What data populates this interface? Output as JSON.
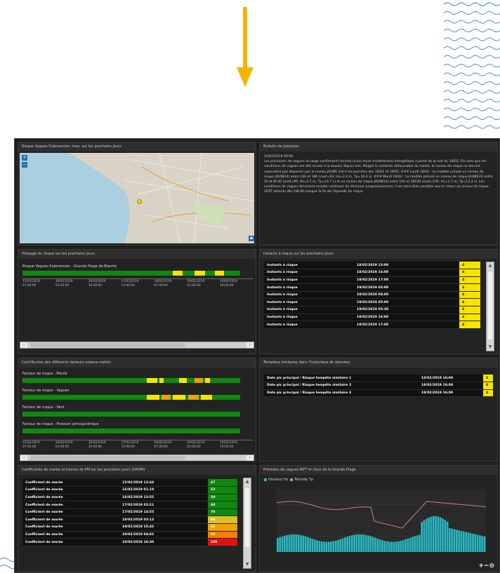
{
  "map_panel": {
    "title": "Risque Vagues-Submersion: max. sur les prochains jours",
    "zoom_in": "+",
    "zoom_out": "−"
  },
  "bulletin_panel": {
    "title": "Bulletin de prévision",
    "date": "15/02/2019 09:00",
    "text": "Les prévisions de vagues au large confirment l'arrivée d'une houle modérément énergétique à partir de la nuit du 18/02. On note que les conditions de vagues ont été revues à la hausse depuis hier. Malgré le contexte défavorable de marée, le niveau de risque ne devrait cependant pas dépasser pas le niveau JAUNE entre les journées des 18/02 et 19/02. ### Lundi 18/02 : Le modèle prévoit un niveau de risque JAUNE(4) entre 13h et 18h (coef=93, Hs=3.3 m, Tp=16.4 s). ### Mardi 19/02 : Le modèle prévoit un niveau de risque JAUNE(4) entre 2h et 6h30 (coef=99, Hs=3.1 m, Tp=14.7 s) et un niveau de risque JAUNE(4) entre 15h et 18h30 (coef=105, Hs=2.7 m, Tp=13.3 s). Les conditions de vagues devraient ensuite continuer de diminuer progressivement, il est alors bien possible que le retour au niveau de risque VERT attendu dès 18h30 marque la fin de l'épisode de risque."
  },
  "phasage_panel": {
    "title": "Phasage du risque sur les prochains jours",
    "series_label": "Risque Vagues-Submersion - Grande Plage de Biarritz",
    "ticks": [
      "15/02/2019\n07:00:00",
      "16/02/2019\n01:00:00",
      "16/02/2019\n19:00:00",
      "17/02/2019\n13:00:00",
      "18/02/2019\n07:00:00",
      "19/02/2019\n01:00:00",
      "19/02/2019\n19:00:00"
    ]
  },
  "instants_panel": {
    "title": "Instants à risque sur les prochains jours",
    "rows": [
      {
        "label": "Instants à risque",
        "date": "18/02/2019 13:00",
        "val": "4"
      },
      {
        "label": "Instants à risque",
        "date": "18/02/2019 16:00",
        "val": "4"
      },
      {
        "label": "Instants à risque",
        "date": "18/02/2019 17:00",
        "val": "4"
      },
      {
        "label": "Instants à risque",
        "date": "19/02/2019 03:00",
        "val": "4"
      },
      {
        "label": "Instants à risque",
        "date": "19/02/2019 04:00",
        "val": "4"
      },
      {
        "label": "Instants à risque",
        "date": "19/02/2019 05:00",
        "val": "4"
      },
      {
        "label": "Instants à risque",
        "date": "19/02/2019 05:30",
        "val": "4"
      },
      {
        "label": "Instants à risque",
        "date": "19/02/2019 16:00",
        "val": "4"
      },
      {
        "label": "Instants à risque",
        "date": "19/02/2019 17:00",
        "val": "4"
      }
    ]
  },
  "contrib_panel": {
    "title": "Contribution des différents facteurs océano-météo",
    "factors": [
      "Facteur de risque - Marée",
      "Facteur de risque - Vagues",
      "Facteur de risque - Vent",
      "Facteur de risque - Pression atmosphérique"
    ],
    "ticks": [
      "15/02/2019\n07:00:00",
      "16/02/2019\n01:00:00",
      "16/02/2019\n19:00:00",
      "17/02/2019\n13:00:00",
      "18/02/2019\n07:00:00",
      "19/02/2019\n01:00:00",
      "19/02/2019\n19:00:00"
    ]
  },
  "tempetes_panel": {
    "title": "Tempêtes similaires dans l'historique de données",
    "rows": [
      {
        "label": "Date pic principal / Risque tempête similaire 1",
        "date": "18/02/2019 16:00",
        "val": "4"
      },
      {
        "label": "Date pic principal / Risque tempête similaire 2",
        "date": "18/02/2019 16:00",
        "val": "4"
      },
      {
        "label": "Date pic principal / Risque tempête similaire 3",
        "date": "18/02/2019 16:00",
        "val": "4"
      }
    ]
  },
  "coef_panel": {
    "title": "Coefficients de marée et heures de PM sur les prochains jours (SHOM)",
    "rows": [
      {
        "label": "Coefficient de marée",
        "date": "15/02/2019 12:44",
        "val": "47",
        "color": "#0e8a0e"
      },
      {
        "label": "Coefficient de marée",
        "date": "16/02/2019 01:19",
        "val": "52",
        "color": "#0e8a0e"
      },
      {
        "label": "Coefficient de marée",
        "date": "16/02/2019 13:55",
        "val": "59",
        "color": "#0e8a0e"
      },
      {
        "label": "Coefficient de marée",
        "date": "17/02/2019 02:21",
        "val": "68",
        "color": "#0e8a0e"
      },
      {
        "label": "Coefficient de marée",
        "date": "17/02/2019 14:53",
        "val": "76",
        "color": "#0e8a0e"
      },
      {
        "label": "Coefficient de marée",
        "date": "18/02/2019 03:13",
        "val": "84",
        "color": "#e0c020"
      },
      {
        "label": "Coefficient de marée",
        "date": "18/02/2019 15:42",
        "val": "92",
        "color": "#f0a000"
      },
      {
        "label": "Coefficient de marée",
        "date": "19/02/2019 04:02",
        "val": "99",
        "color": "#f08000"
      },
      {
        "label": "Coefficient de marée",
        "date": "19/02/2019 16:30",
        "val": "105",
        "color": "#e01010"
      }
    ]
  },
  "waves_panel": {
    "title": "Prévision de vagues WFT en face de la Grande Plage",
    "legend_hs": "Hauteur Hs",
    "legend_tp": "Période Tp",
    "zoom": "+−⊙"
  },
  "colors": {
    "green": "#0e8a0e",
    "yellow": "#f5e400",
    "orange": "#f0a000",
    "accent": "#f5b400"
  }
}
